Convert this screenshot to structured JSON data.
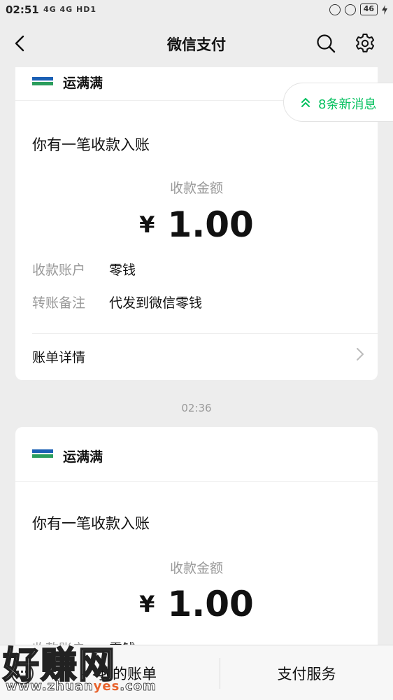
{
  "status_bar": {
    "time": "02:51",
    "signals": "4G 4G HD1",
    "battery": "46"
  },
  "navbar": {
    "title": "微信支付"
  },
  "new_messages": {
    "label": "8条新消息"
  },
  "cards": [
    {
      "merchant": "运满满",
      "title": "你有一笔收款入账",
      "amount_label": "收款金额",
      "currency": "¥",
      "amount": "1.00",
      "account_key": "收款账户",
      "account_value": "零钱",
      "note_key": "转账备注",
      "note_value": "代发到微信零钱",
      "detail_label": "账单详情"
    },
    {
      "timestamp": "02:36",
      "merchant": "运满满",
      "title": "你有一笔收款入账",
      "amount_label": "收款金额",
      "currency": "¥",
      "amount": "1.00",
      "account_key": "收款账户",
      "account_value": "零钱"
    }
  ],
  "tabbar": {
    "tabs": [
      {
        "label": "我的账单"
      },
      {
        "label": "支付服务"
      }
    ]
  },
  "watermark": {
    "main": "好赚网",
    "domain_prefix": "www.zhuan",
    "domain_highlight": "yes",
    "domain_suffix": ".com"
  },
  "colors": {
    "accent_green": "#07c160",
    "background": "#ededed"
  }
}
